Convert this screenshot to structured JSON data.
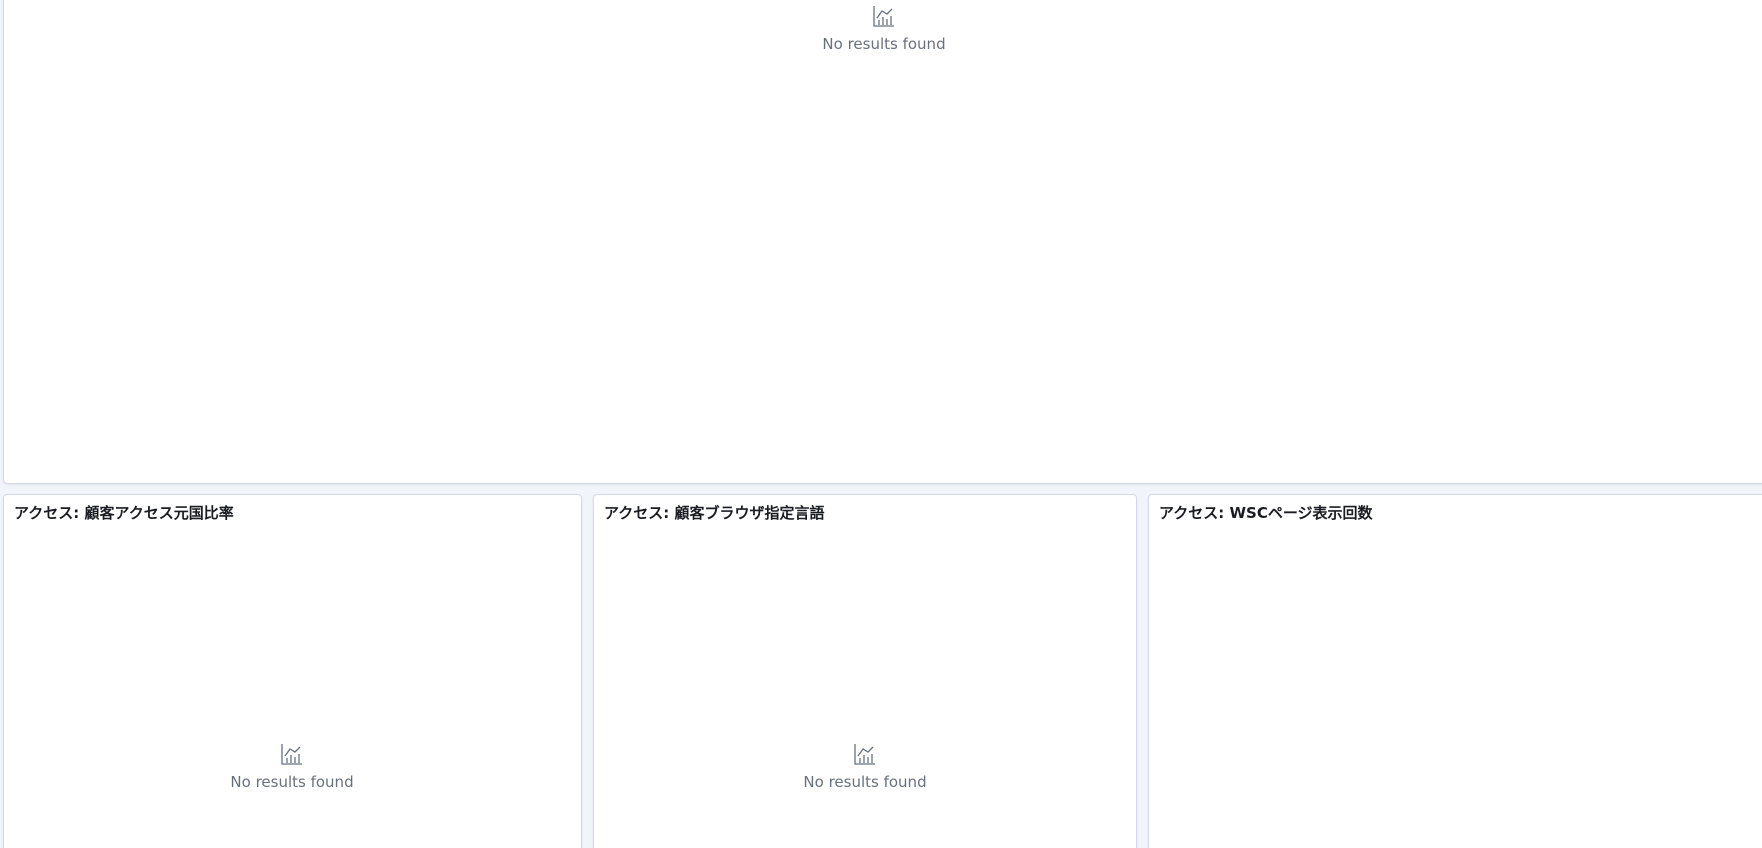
{
  "dashboard": {
    "top_panel": {
      "empty_icon": "chart-line-icon",
      "empty_message": "No results found"
    },
    "panels": [
      {
        "title": "アクセス: 顧客アクセス元国比率",
        "empty_icon": "chart-line-icon",
        "empty_message": "No results found"
      },
      {
        "title": "アクセス: 顧客ブラウザ指定言語",
        "empty_icon": "chart-line-icon",
        "empty_message": "No results found"
      },
      {
        "title": "アクセス: WSCページ表示回数"
      }
    ]
  },
  "colors": {
    "page_background": "#f1f4fa",
    "panel_border": "#d3dae6",
    "title_text": "#1a1c21",
    "muted_text": "#69707d"
  }
}
